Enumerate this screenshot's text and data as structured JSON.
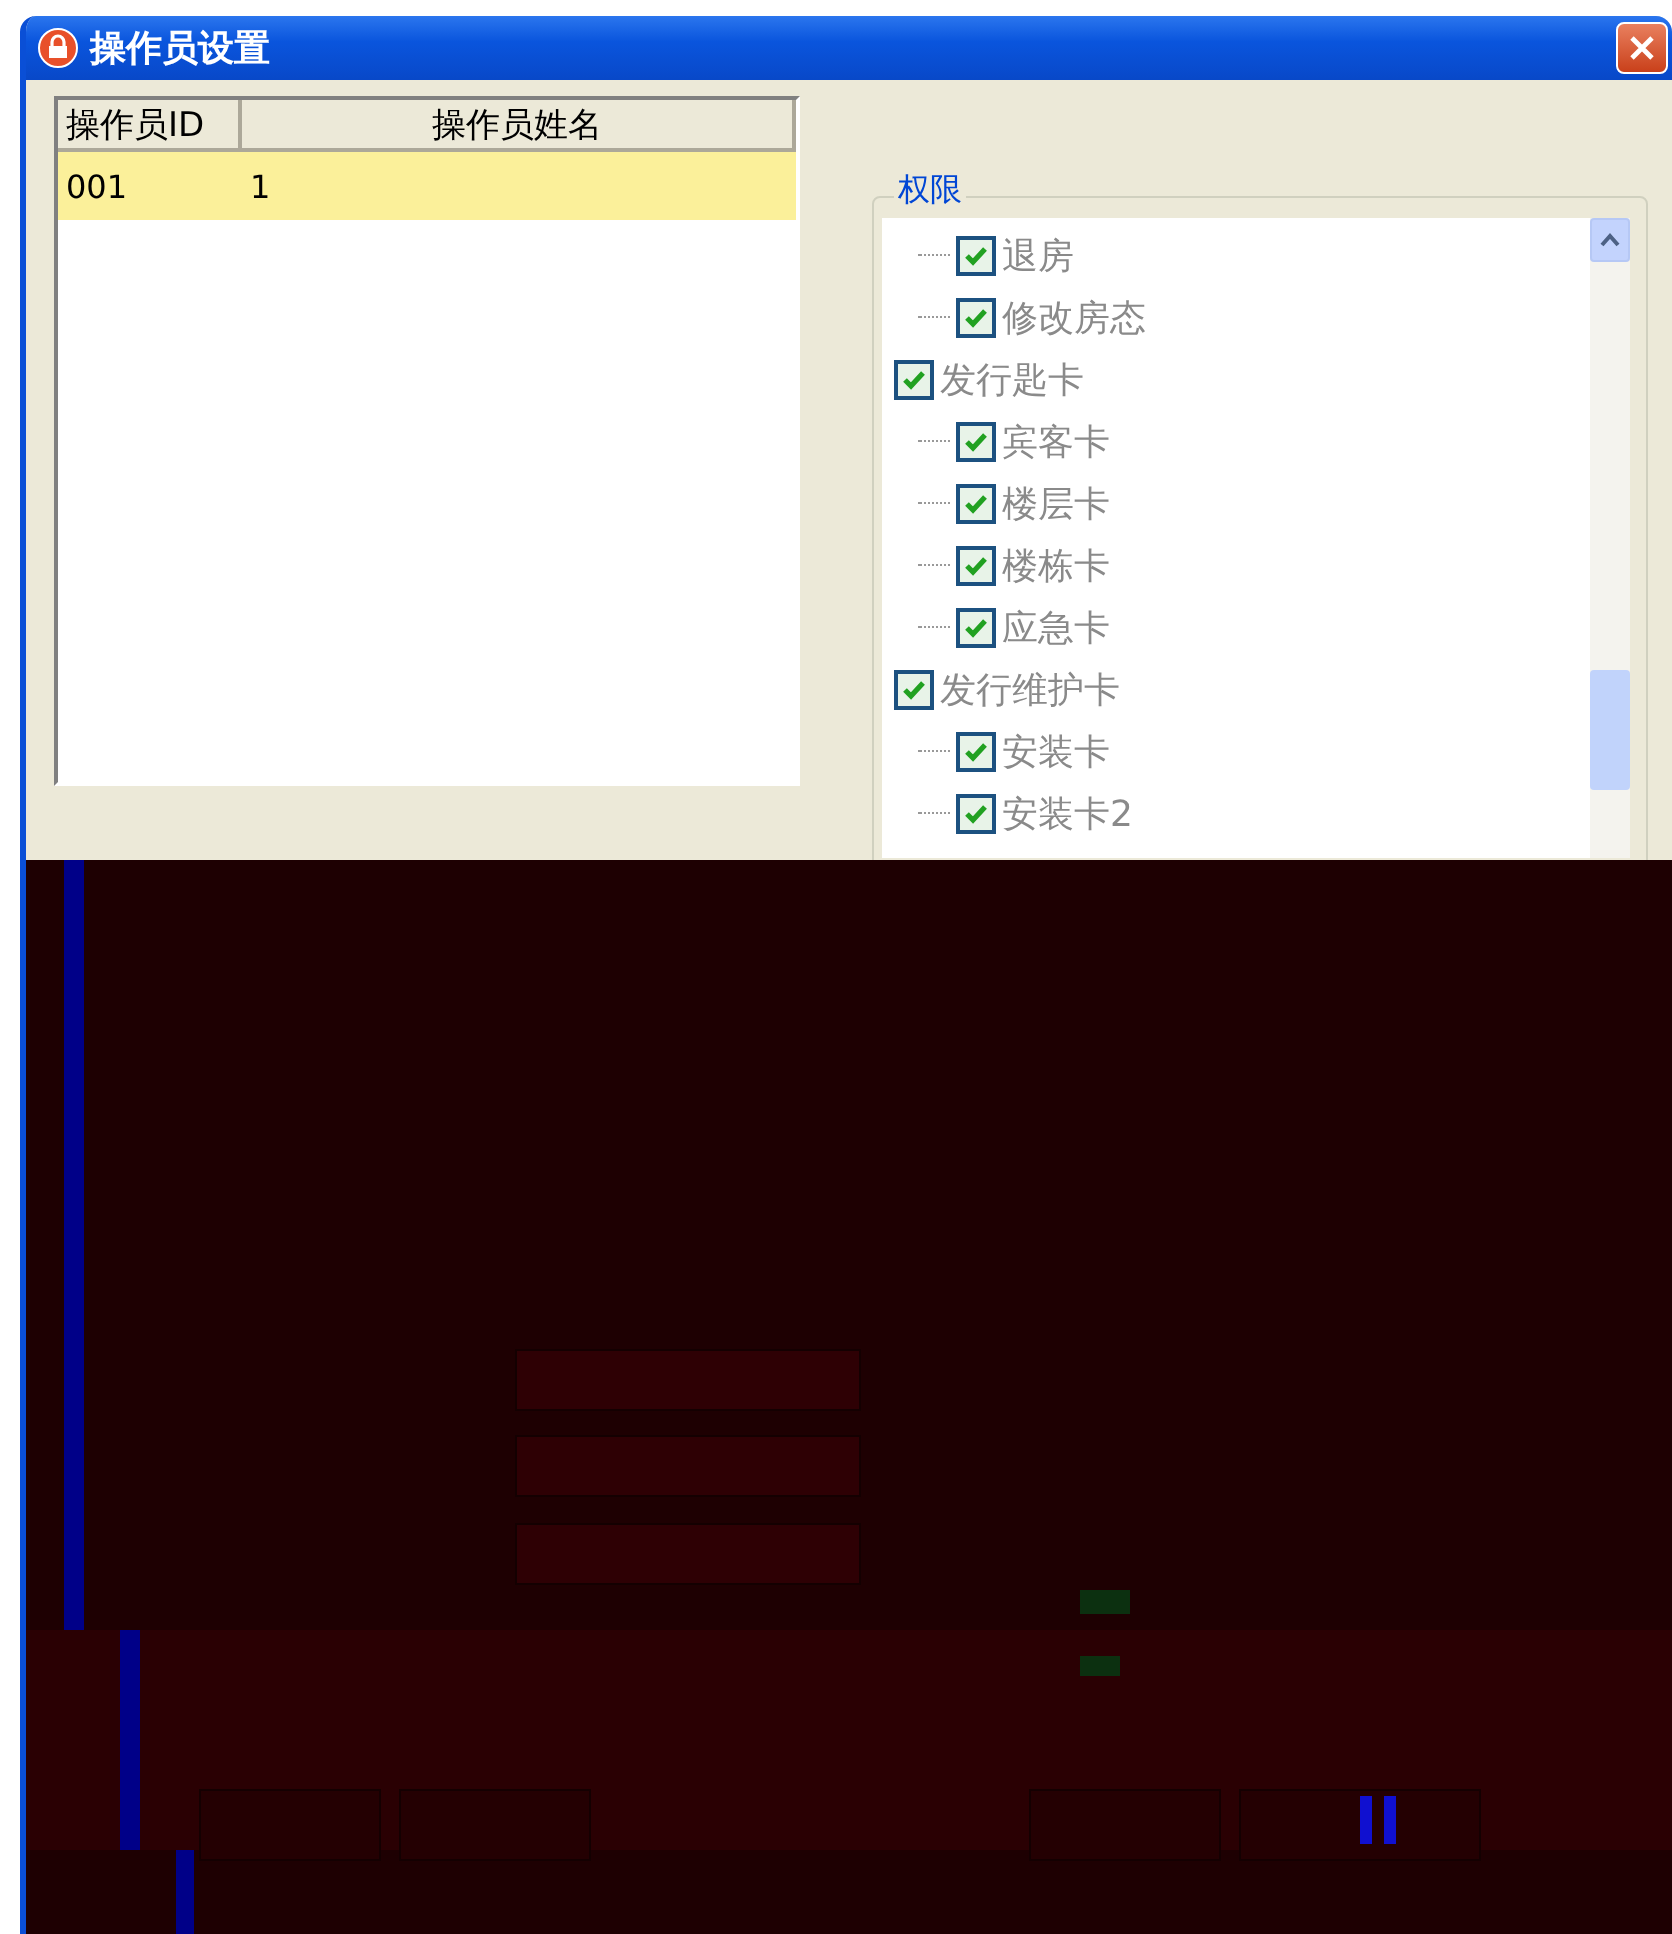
{
  "window": {
    "title": "操作员设置"
  },
  "operators": {
    "columns": [
      "操作员ID",
      "操作员姓名"
    ],
    "rows": [
      {
        "cells": [
          "001",
          "1"
        ],
        "selected": true
      }
    ]
  },
  "permissions": {
    "title": "权限",
    "tree": [
      {
        "children": [
          {
            "label": "退房",
            "checked": true
          },
          {
            "label": "修改房态",
            "checked": true
          }
        ]
      },
      {
        "label": "发行匙卡",
        "checked": true,
        "children": [
          {
            "label": "宾客卡",
            "checked": true
          },
          {
            "label": "楼层卡",
            "checked": true
          },
          {
            "label": "楼栋卡",
            "checked": true
          },
          {
            "label": "应急卡",
            "checked": true
          }
        ]
      },
      {
        "label": "发行维护卡",
        "checked": true,
        "children": [
          {
            "label": "安装卡",
            "checked": true
          },
          {
            "label": "安装卡2",
            "checked": true
          }
        ]
      }
    ]
  }
}
